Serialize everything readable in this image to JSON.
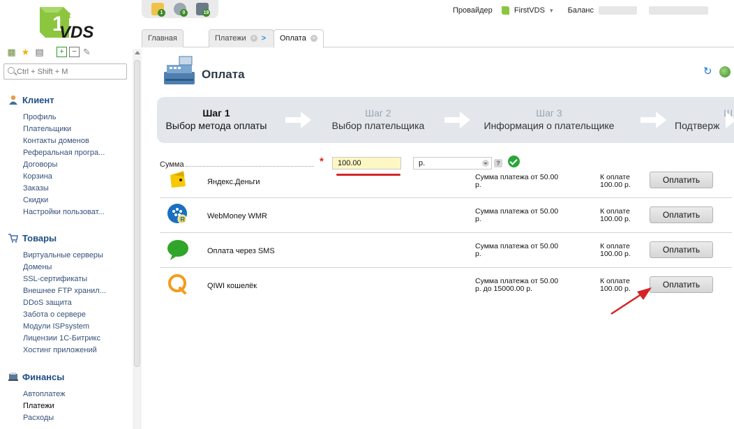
{
  "sidebar": {
    "search_placeholder": "Ctrl + Shift + M",
    "sections": [
      {
        "title": "Клиент",
        "icon": "user-icon",
        "items": [
          "Профиль",
          "Плательщики",
          "Контакты доменов",
          "Реферальная програ...",
          "Договоры",
          "Корзина",
          "Заказы",
          "Скидки",
          "Настройки пользоват..."
        ]
      },
      {
        "title": "Товары",
        "icon": "cart-icon",
        "items": [
          "Виртуальные серверы",
          "Домены",
          "SSL-сертификаты",
          "Внешнее FTP хранил...",
          "DDoS защита",
          "Забота о сервере",
          "Модули ISPsystem",
          "Лицензии 1С-Битрикс",
          "Хостинг приложений"
        ]
      },
      {
        "title": "Финансы",
        "icon": "finance-icon",
        "items": [
          "Автоплатеж",
          "Платежи",
          "Расходы"
        ]
      }
    ]
  },
  "logo": {
    "sup": "st",
    "digit": "1",
    "text": "VDS"
  },
  "topbar": {
    "badges": [
      "1",
      "0",
      "19"
    ],
    "provider_label": "Провайдер",
    "provider_name": "FirstVDS",
    "balance_label": "Баланс"
  },
  "tabs": {
    "home": "Главная",
    "payments": "Платежи",
    "sep": ">",
    "payment": "Оплата"
  },
  "page": {
    "title": "Оплата"
  },
  "wizard": {
    "steps": [
      {
        "num": "Шаг 1",
        "label": "Выбор метода оплаты"
      },
      {
        "num": "Шаг 2",
        "label": "Выбор плательщика"
      },
      {
        "num": "Шаг 3",
        "label": "Информация о плательщике"
      },
      {
        "num": "Ш",
        "label": "Подтверж"
      }
    ]
  },
  "form": {
    "sum_label": "Сумма",
    "required_mark": "*",
    "sum_value": "100.00",
    "currency": "р.",
    "help": "?"
  },
  "methods": [
    {
      "name": "Яндекс.Деньги",
      "note_line1": "Сумма платежа от 50.00",
      "note_line2": "р.",
      "pay_line1": "К оплате",
      "pay_line2": "100.00 р.",
      "button": "Оплатить"
    },
    {
      "name": "WebMoney WMR",
      "note_line1": "Сумма платежа от 50.00",
      "note_line2": "р.",
      "pay_line1": "К оплате",
      "pay_line2": "100.00 р.",
      "button": "Оплатить"
    },
    {
      "name": "Оплата через SMS",
      "note_line1": "Сумма платежа от 50.00",
      "note_line2": "р.",
      "pay_line1": "К оплате",
      "pay_line2": "100.00 р.",
      "button": "Оплатить"
    },
    {
      "name": "QIWI кошелёк",
      "note_line1": "Сумма платежа от 50.00",
      "note_line2": "р. до 15000.00 р.",
      "pay_line1": "К оплате",
      "pay_line2": "100.00 р.",
      "button": "Оплатить"
    }
  ],
  "colors": {
    "accent": "#1f4e85",
    "wizard_bg": "#e3e7ec",
    "annotation": "#d52424",
    "ok": "#2aa63a"
  }
}
